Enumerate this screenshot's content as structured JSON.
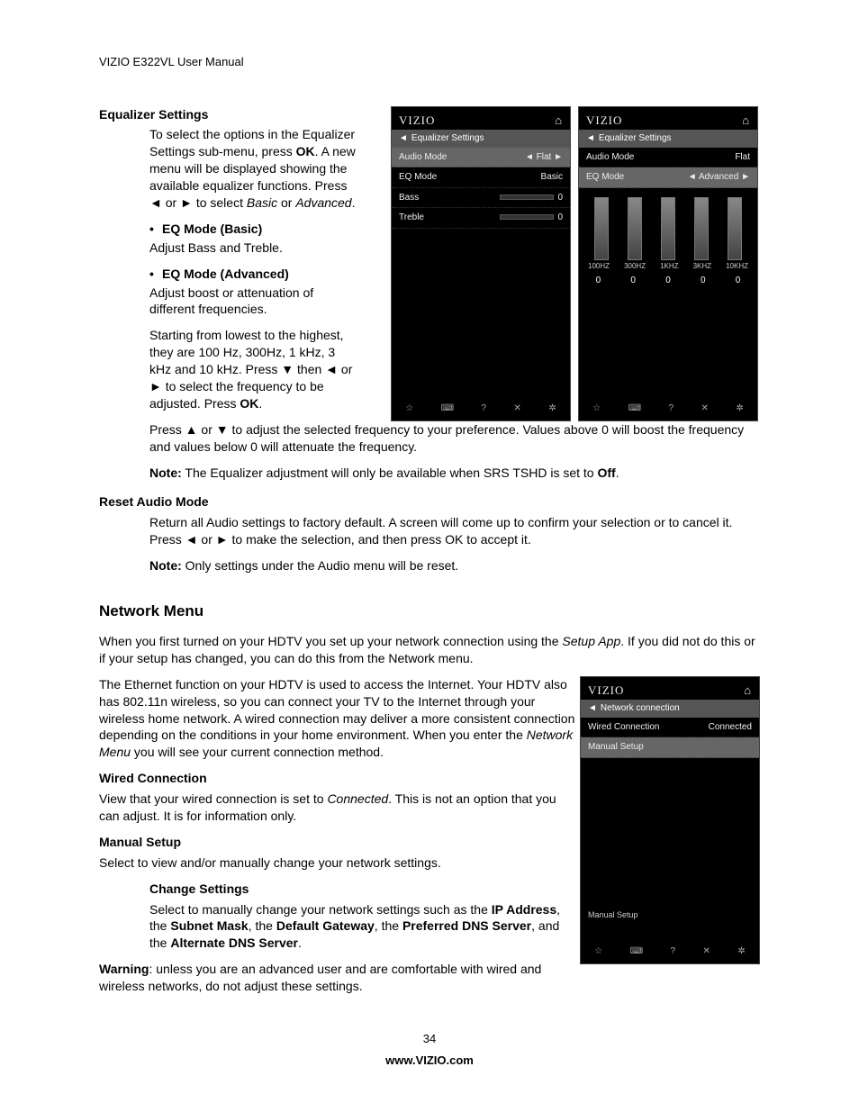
{
  "header": "VIZIO E322VL User Manual",
  "eq": {
    "title": "Equalizer Settings",
    "intro1": "To select the options in the Equalizer Settings sub-menu, press ",
    "ok": "OK",
    "intro2": ". A new menu will be displayed showing the available equalizer functions. Press ◄ or ► to select ",
    "basic": "Basic",
    "or": " or ",
    "advanced": "Advanced",
    "period": ".",
    "mode_basic_h": "EQ Mode (Basic)",
    "mode_basic_t": "Adjust Bass and Treble.",
    "mode_adv_h": "EQ Mode (Advanced)",
    "mode_adv_t1": "Adjust boost or attenuation of different frequencies.",
    "mode_adv_t2a": "Starting from lowest to the highest, they are 100 Hz, 300Hz, 1 kHz, 3 kHz and 10 kHz. Press ▼ then ◄ or ► to select the frequency to be adjusted. Press ",
    "mode_adv_t2b": "OK",
    "mode_adv_t2c": ".",
    "wrap1": "Press ▲ or ▼ to adjust the selected frequency to your preference. Values above 0 will boost the frequency and values below 0 will attenuate the frequency.",
    "note_l": "Note:",
    "note_t": " The Equalizer adjustment will only be available when SRS TSHD is set to ",
    "off": "Off",
    "note_end": "."
  },
  "reset": {
    "title": "Reset Audio Mode",
    "t1": "Return all Audio settings to factory default. A screen will come up to confirm your selection or to cancel it. Press ◄ or ► to make the selection, and then press OK to accept it.",
    "note_l": "Note:",
    "note_t": " Only settings under the Audio menu will be reset."
  },
  "net": {
    "title": "Network Menu",
    "p1a": "When you first turned on your HDTV you set up your network connection using the ",
    "p1b": "Setup App",
    "p1c": ". If you did not do this or if your setup has changed, you can do this from the Network menu.",
    "p2a": "The Ethernet function on your HDTV is used to access the Internet. Your HDTV also has 802.11n wireless, so you can connect your TV to the Internet through your wireless home network. A wired connection may deliver a more consistent connection depending on the conditions in your home environment. When you enter the ",
    "p2b": "Network Menu",
    "p2c": " you will see your current connection method.",
    "wired_h": "Wired Connection",
    "wired_t1": "View that your wired connection is set to ",
    "wired_t2": "Connected",
    "wired_t3": ". This is not an option that you can adjust. It is for information only.",
    "manual_h": "Manual Setup",
    "manual_t": "Select to view and/or manually change your network settings.",
    "change_h": "Change Settings",
    "change_t1": "Select to manually change your network settings such as the ",
    "change_b1": "IP Address",
    "change_c1": ", the ",
    "change_b2": "Subnet Mask",
    "change_c2": ", the ",
    "change_b3": "Default Gateway",
    "change_c3": ", the ",
    "change_b4": "Preferred DNS Server",
    "change_c4": ", and the ",
    "change_b5": "Alternate DNS Server",
    "change_c5": ".",
    "warn_l": "Warning",
    "warn_t": ": unless you are an advanced user and are comfortable with wired and wireless networks, do not adjust these settings."
  },
  "page": "34",
  "site": "www.VIZIO.com",
  "scr1": {
    "brand": "VIZIO",
    "sub": "Equalizer Settings",
    "audio_mode_l": "Audio Mode",
    "audio_mode_v": "Flat",
    "eq_mode_l": "EQ Mode",
    "eq_mode_v": "Basic",
    "bass_l": "Bass",
    "bass_v": "0",
    "treble_l": "Treble",
    "treble_v": "0"
  },
  "scr2": {
    "brand": "VIZIO",
    "sub": "Equalizer Settings",
    "audio_mode_l": "Audio Mode",
    "audio_mode_v": "Flat",
    "eq_mode_l": "EQ Mode",
    "eq_mode_v": "Advanced",
    "freqs": [
      "100HZ",
      "300HZ",
      "1KHZ",
      "3KHZ",
      "10KHZ"
    ],
    "vals": [
      "0",
      "0",
      "0",
      "0",
      "0"
    ]
  },
  "scr3": {
    "brand": "VIZIO",
    "sub": "Network connection",
    "wired_l": "Wired Connection",
    "wired_v": "Connected",
    "manual_l": "Manual Setup",
    "manual_foot": "Manual Setup"
  },
  "icons": {
    "home": "⌂",
    "back": "◄",
    "left_caret": "◄",
    "right_caret": "►",
    "star": "☆",
    "kb": "⌨",
    "q": "?",
    "x": "✕",
    "gear": "✲"
  }
}
